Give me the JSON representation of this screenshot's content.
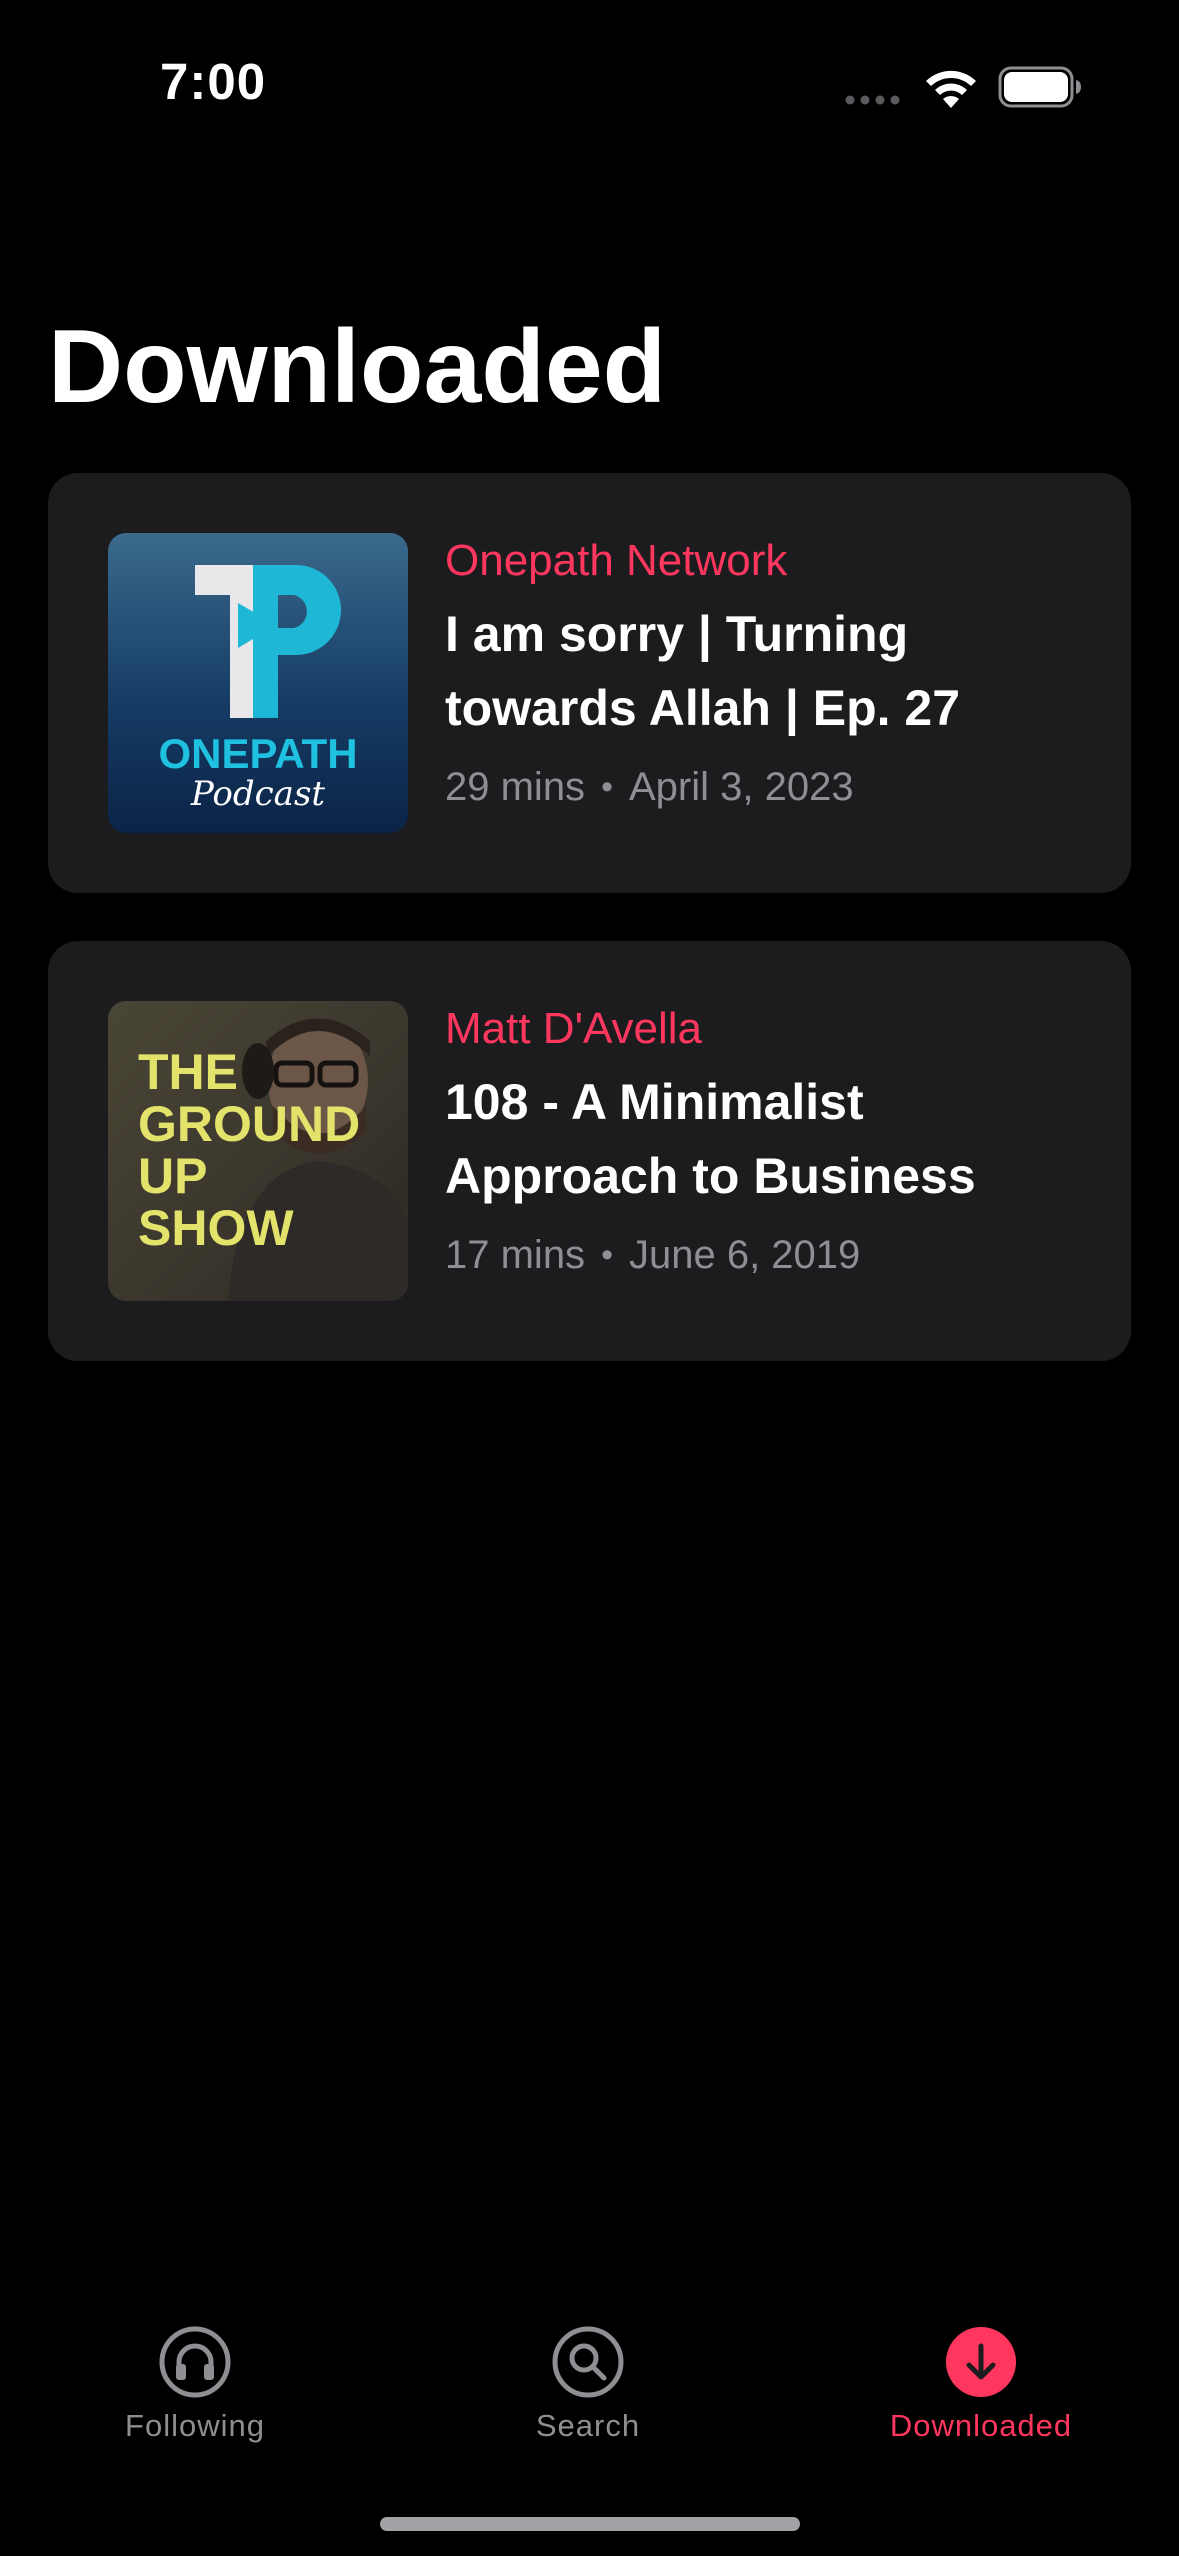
{
  "status_bar": {
    "time": "7:00"
  },
  "page": {
    "title": "Downloaded"
  },
  "episodes": [
    {
      "show": "Onepath Network",
      "title": "I am sorry | Turning towards Allah | Ep. 27",
      "duration": "29 mins",
      "date": "April 3, 2023",
      "artwork": {
        "brand_top": "ONEPATH",
        "brand_bottom": "Podcast"
      }
    },
    {
      "show": "Matt D'Avella",
      "title": "108 - A Minimalist Approach to Business",
      "duration": "17 mins",
      "date": "June 6, 2019",
      "artwork": {
        "line1": "THE",
        "line2": "GROUND",
        "line3": "UP",
        "line4": "SHOW"
      }
    }
  ],
  "meta_separator": "•",
  "tabs": [
    {
      "label": "Following",
      "icon": "headphones-icon",
      "active": false
    },
    {
      "label": "Search",
      "icon": "magnifier-icon",
      "active": false
    },
    {
      "label": "Downloaded",
      "icon": "download-arrow-icon",
      "active": true
    }
  ],
  "colors": {
    "accent": "#ff375f",
    "card_background": "#1c1c1e",
    "secondary_text": "#8e8e93",
    "background": "#000000"
  }
}
